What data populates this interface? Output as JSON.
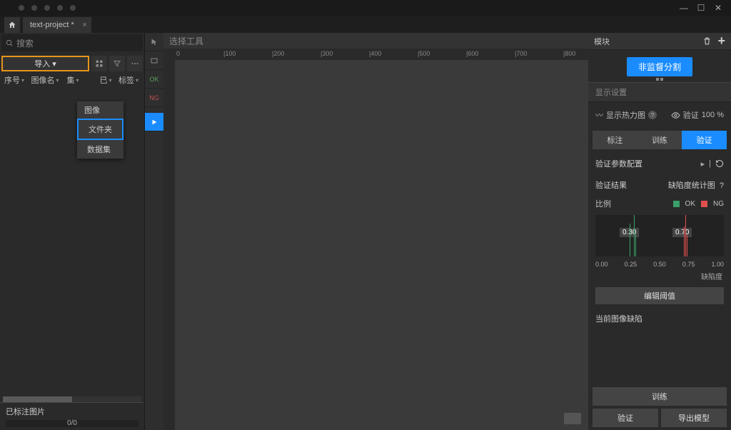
{
  "titlebar": {
    "project_tab": "text-project *"
  },
  "left": {
    "search_placeholder": "搜索",
    "import_label": "导入 ▾",
    "cols": {
      "c1": "序号",
      "c2": "图像名",
      "c3": "集",
      "c4": "已",
      "c5": "标签"
    },
    "dropdown": {
      "head": "图像",
      "item1": "文件夹",
      "item2": "数据集"
    },
    "labeled_title": "已标注图片",
    "progress": "0/0"
  },
  "toolstrip": {
    "ok": "OK",
    "ng": "NG"
  },
  "canvas": {
    "select_tool": "选择工具",
    "ruler": [
      "0",
      "|100",
      "|200",
      "|300",
      "|400",
      "|500",
      "|600",
      "|700",
      "|800"
    ]
  },
  "right": {
    "module_label": "模块",
    "seg_btn": "非监督分割",
    "display_section": "显示设置",
    "heatmap": "显示热力图",
    "verify": "验证",
    "verify_pct": "100 %",
    "modes": {
      "m1": "标注",
      "m2": "训练",
      "m3": "验证"
    },
    "param_title": "验证参数配置",
    "result_title": "验证结果",
    "defect_chart": "缺陷度统计图",
    "ratio": "比例",
    "ok": "OK",
    "ng": "NG",
    "axis": [
      "0.00",
      "0.25",
      "0.50",
      "0.75",
      "1.00"
    ],
    "axis_label": "缺陷度",
    "edit_threshold": "编辑阈值",
    "current_defect": "当前图像缺陷",
    "train_btn": "训练",
    "verify_btn": "验证",
    "export_btn": "导出模型"
  },
  "chart_data": {
    "type": "bar",
    "title": "缺陷度统计图",
    "xlabel": "缺陷度",
    "ylabel": "比例",
    "xlim": [
      0,
      1
    ],
    "series": [
      {
        "name": "OK",
        "color": "#3aa06a",
        "values": [
          {
            "x": 0.3,
            "label": "0.30",
            "bars": [
              0.27,
              0.3,
              0.31
            ]
          }
        ]
      },
      {
        "name": "NG",
        "color": "#e05050",
        "values": [
          {
            "x": 0.7,
            "label": "0.70",
            "bars": [
              0.69,
              0.7,
              0.71
            ]
          }
        ]
      }
    ]
  }
}
